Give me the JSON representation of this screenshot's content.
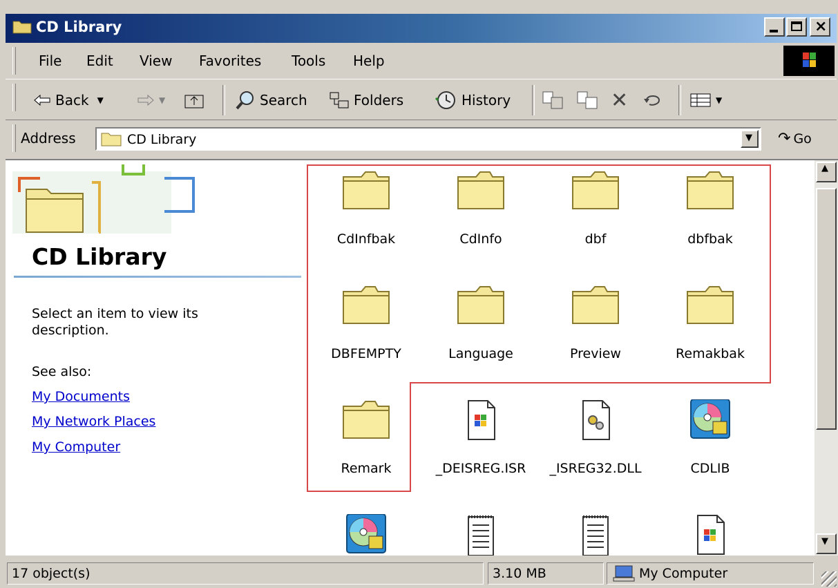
{
  "window": {
    "title": "CD Library"
  },
  "menu": [
    "File",
    "Edit",
    "View",
    "Favorites",
    "Tools",
    "Help"
  ],
  "toolbar": {
    "back": "Back",
    "search": "Search",
    "folders": "Folders",
    "history": "History"
  },
  "address": {
    "label": "Address",
    "value": "CD Library",
    "go": "Go"
  },
  "left_pane": {
    "title": "CD Library",
    "description": "Select an item to view its description.",
    "see_also": "See also:",
    "links": [
      "My Documents",
      "My Network Places",
      "My Computer"
    ]
  },
  "items": [
    {
      "name": "CdInfbak",
      "type": "folder-icon"
    },
    {
      "name": "CdInfo",
      "type": "folder-icon"
    },
    {
      "name": "dbf",
      "type": "folder-icon"
    },
    {
      "name": "dbfbak",
      "type": "folder-icon"
    },
    {
      "name": "DBFEMPTY",
      "type": "folder-icon"
    },
    {
      "name": "Language",
      "type": "folder-icon"
    },
    {
      "name": "Preview",
      "type": "folder-icon"
    },
    {
      "name": "Remakbak",
      "type": "folder-icon"
    },
    {
      "name": "Remark",
      "type": "folder-icon"
    },
    {
      "name": "_DEISREG.ISR",
      "type": "installer-file-icon"
    },
    {
      "name": "_ISREG32.DLL",
      "type": "dll-file-icon"
    },
    {
      "name": "CDLIB",
      "type": "cd-app-icon"
    },
    {
      "name": "",
      "type": "cd-app-icon"
    },
    {
      "name": "",
      "type": "text-file-icon"
    },
    {
      "name": "",
      "type": "text-file-icon"
    },
    {
      "name": "",
      "type": "installer-file-icon"
    }
  ],
  "status": {
    "objects": "17 object(s)",
    "size": "3.10 MB",
    "zone": "My Computer"
  }
}
